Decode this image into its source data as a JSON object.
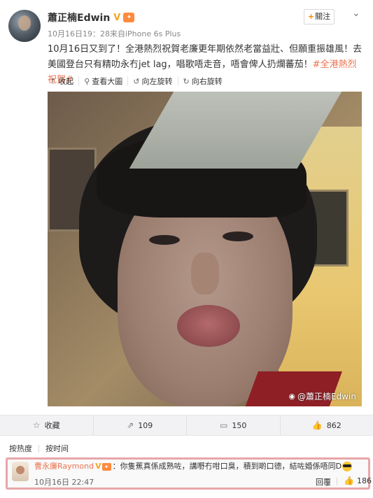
{
  "post": {
    "username": "蕭正楠Edwin",
    "verified_mark": "V",
    "meta": "10月16日19：28来自iPhone 6s Plus",
    "follow_label": "關注",
    "follow_plus": "+",
    "menu_icon": "chevron-down-icon",
    "text_main": "10月16日又到了！全港熱烈祝賀老廉更年期依然老當益壯、但願重振雄風！去美國登台只有精叻永冇jet lag，唱歌唔走音，唔會俾人扔爛蕃茄！",
    "hashtag": "#全港熱烈祝賀#"
  },
  "photo_toolbar": [
    {
      "icon": "collapse-icon",
      "glyph": "⇡",
      "label": "收起"
    },
    {
      "icon": "zoom-icon",
      "glyph": "⚲",
      "label": "查看大圖"
    },
    {
      "icon": "rotate-left-icon",
      "glyph": "↺",
      "label": "向左旋转"
    },
    {
      "icon": "rotate-right-icon",
      "glyph": "↻",
      "label": "向右旋转"
    }
  ],
  "photo": {
    "watermark": "@蕭正楠Edwin",
    "watermark_icon": "weibo-icon"
  },
  "actions": [
    {
      "icon": "star-icon",
      "glyph": "☆",
      "label": "收藏"
    },
    {
      "icon": "repost-icon",
      "glyph": "⇗",
      "label": "109"
    },
    {
      "icon": "comment-icon",
      "glyph": "▭",
      "label": "150"
    },
    {
      "icon": "thumbs-up-icon",
      "glyph": "👍",
      "label": "862"
    }
  ],
  "sort": {
    "hot": "按热度",
    "time": "按时间"
  },
  "comment": {
    "name": "曹永廉Raymond",
    "verified_mark": "V",
    "text": "：你隻蕉真係成熟咗，講嘢冇咁口臭，積到啲口德，結咗婚係唔同D",
    "emoji_icon": "sunglasses-emoji-icon",
    "time": "10月16日 22:47",
    "reply_label": "回覆",
    "likes": "186",
    "like_glyph": "👍"
  },
  "colors": {
    "accent": "#eb7350",
    "verified": "#f5a623",
    "highlight_border": "#e8a6a9"
  }
}
